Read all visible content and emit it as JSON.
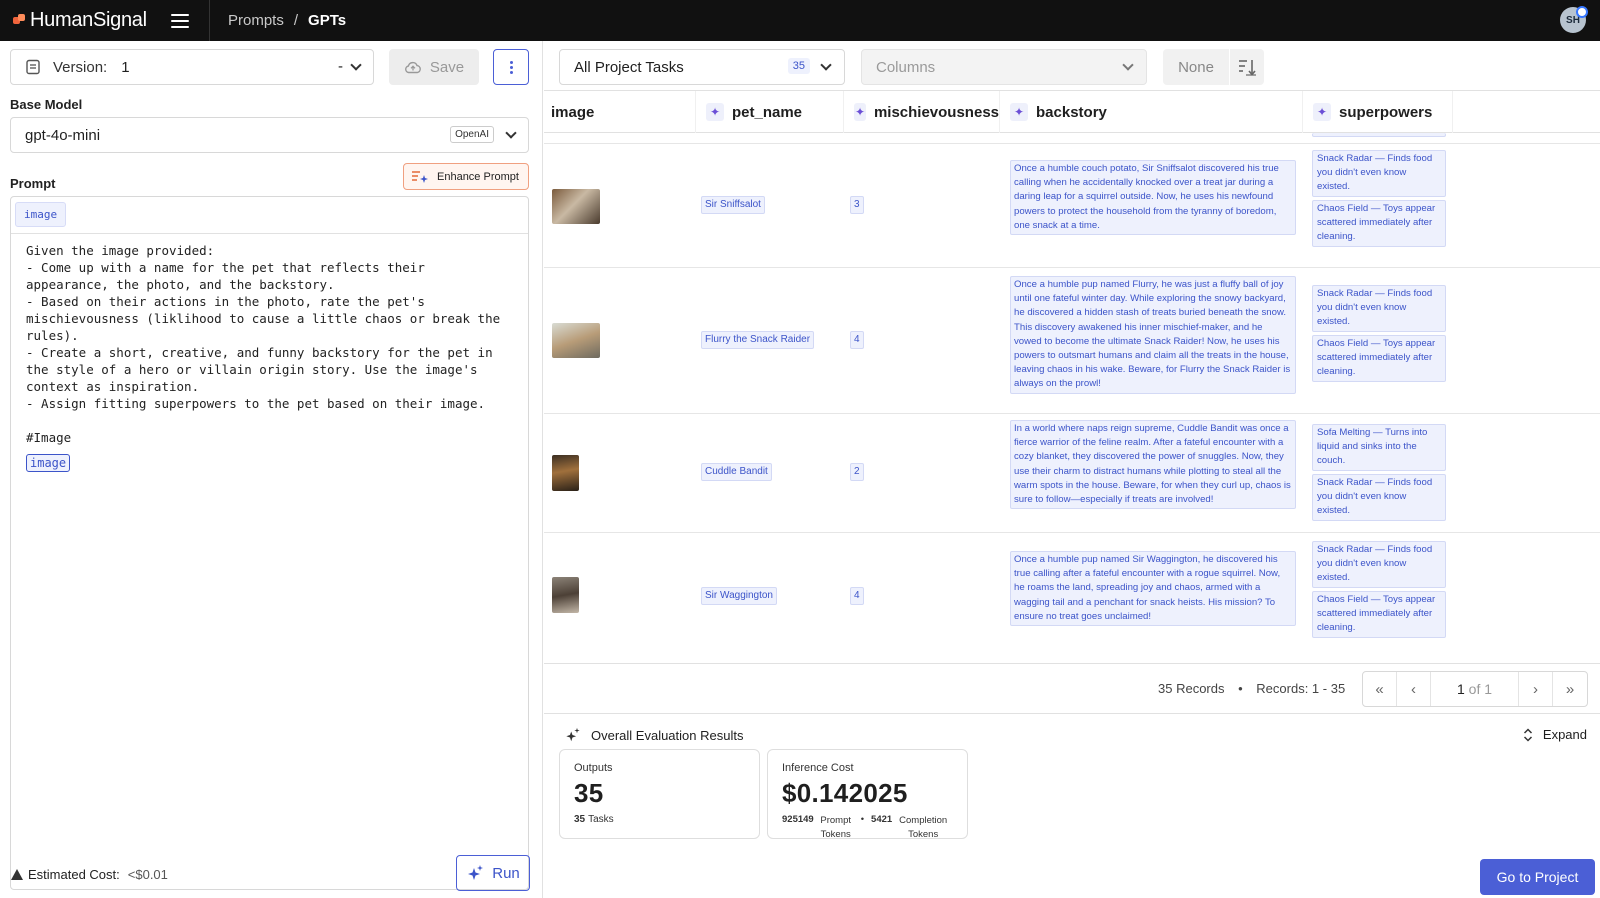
{
  "topbar": {
    "brand": "HumanSignal",
    "breadcrumb": [
      "Prompts",
      "GPTs"
    ],
    "avatar_initials": "SH"
  },
  "left": {
    "version_label": "Version:",
    "version_value": "1",
    "version_dash": "-",
    "save_label": "Save",
    "base_model_label": "Base Model",
    "model_value": "gpt-4o-mini",
    "model_provider": "OpenAI",
    "enhance_label": "Enhance Prompt",
    "prompt_label": "Prompt",
    "prompt_var_chip": "image",
    "prompt_text": "Given the image provided:\n- Come up with a name for the pet that reflects their\nappearance, the photo, and the backstory.\n- Based on their actions in the photo, rate the pet's\nmischievousness (liklihood to cause a little chaos or break the\nrules).\n- Create a short, creative, and funny backstory for the pet in\nthe style of a hero or villain origin story. Use the image's\ncontext as inspiration.\n- Assign fitting superpowers to the pet based on their image.\n\n#Image",
    "prompt_inline_var": "image",
    "cost_label": "Estimated Cost:",
    "cost_value": "<$0.01",
    "run_label": "Run"
  },
  "right": {
    "tasks_select": "All Project Tasks",
    "tasks_count": "35",
    "columns_placeholder": "Columns",
    "sort_value": "None",
    "columns": [
      "image",
      "pet_name",
      "mischievousness",
      "backstory",
      "superpowers"
    ],
    "rows": [
      {
        "pet_name": "Sir Sniffsalot",
        "mischievousness": "3",
        "backstory": "Once a humble couch potato, Sir Sniffsalot discovered his true calling when he accidentally knocked over a treat jar during a daring leap for a squirrel outside. Now, he uses his newfound powers to protect the household from the tyranny of boredom, one snack at a time.",
        "superpowers": [
          "Snack Radar — Finds food you didn't even know existed.",
          "Chaos Field — Toys appear scattered immediately after cleaning."
        ]
      },
      {
        "pet_name": "Flurry the Snack Raider",
        "mischievousness": "4",
        "backstory": "Once a humble pup named Flurry, he was just a fluffy ball of joy until one fateful winter day. While exploring the snowy backyard, he discovered a hidden stash of treats buried beneath the snow. This discovery awakened his inner mischief-maker, and he vowed to become the ultimate Snack Raider! Now, he uses his powers to outsmart humans and claim all the treats in the house, leaving chaos in his wake. Beware, for Flurry the Snack Raider is always on the prowl!",
        "superpowers": [
          "Snack Radar — Finds food you didn't even know existed.",
          "Chaos Field — Toys appear scattered immediately after cleaning."
        ]
      },
      {
        "pet_name": "Cuddle Bandit",
        "mischievousness": "2",
        "backstory": "In a world where naps reign supreme, Cuddle Bandit was once a fierce warrior of the feline realm. After a fateful encounter with a cozy blanket, they discovered the power of snuggles. Now, they use their charm to distract humans while plotting to steal all the warm spots in the house. Beware, for when they curl up, chaos is sure to follow—especially if treats are involved!",
        "superpowers": [
          "Sofa Melting — Turns into liquid and sinks into the couch.",
          "Snack Radar — Finds food you didn't even know existed."
        ]
      },
      {
        "pet_name": "Sir Waggington",
        "mischievousness": "4",
        "backstory": "Once a humble pup named Sir Waggington, he discovered his true calling after a fateful encounter with a rogue squirrel. Now, he roams the land, spreading joy and chaos, armed with a wagging tail and a penchant for snack heists. His mission? To ensure no treat goes unclaimed!",
        "superpowers": [
          "Snack Radar — Finds food you didn't even know existed.",
          "Chaos Field — Toys appear scattered immediately after cleaning."
        ]
      }
    ],
    "pager": {
      "records": "35 Records",
      "bullet": "•",
      "range": "Records: 1 - 35",
      "page": "1",
      "of": "of 1"
    },
    "eval": {
      "title": "Overall Evaluation Results",
      "expand": "Expand",
      "outputs_label": "Outputs",
      "outputs_value": "35",
      "tasks_num": "35",
      "tasks_label": "Tasks",
      "cost_label": "Inference Cost",
      "cost_value": "$0.142025",
      "prompt_tokens": "925149",
      "prompt_tokens_label": "Prompt Tokens",
      "completion_tokens": "5421",
      "completion_tokens_label": "Completion Tokens"
    },
    "go_label": "Go to Project"
  },
  "colors": {
    "accent": "#4b5fd6",
    "brand_orange": "#f0643c",
    "tag_bg": "#eef1fd"
  }
}
